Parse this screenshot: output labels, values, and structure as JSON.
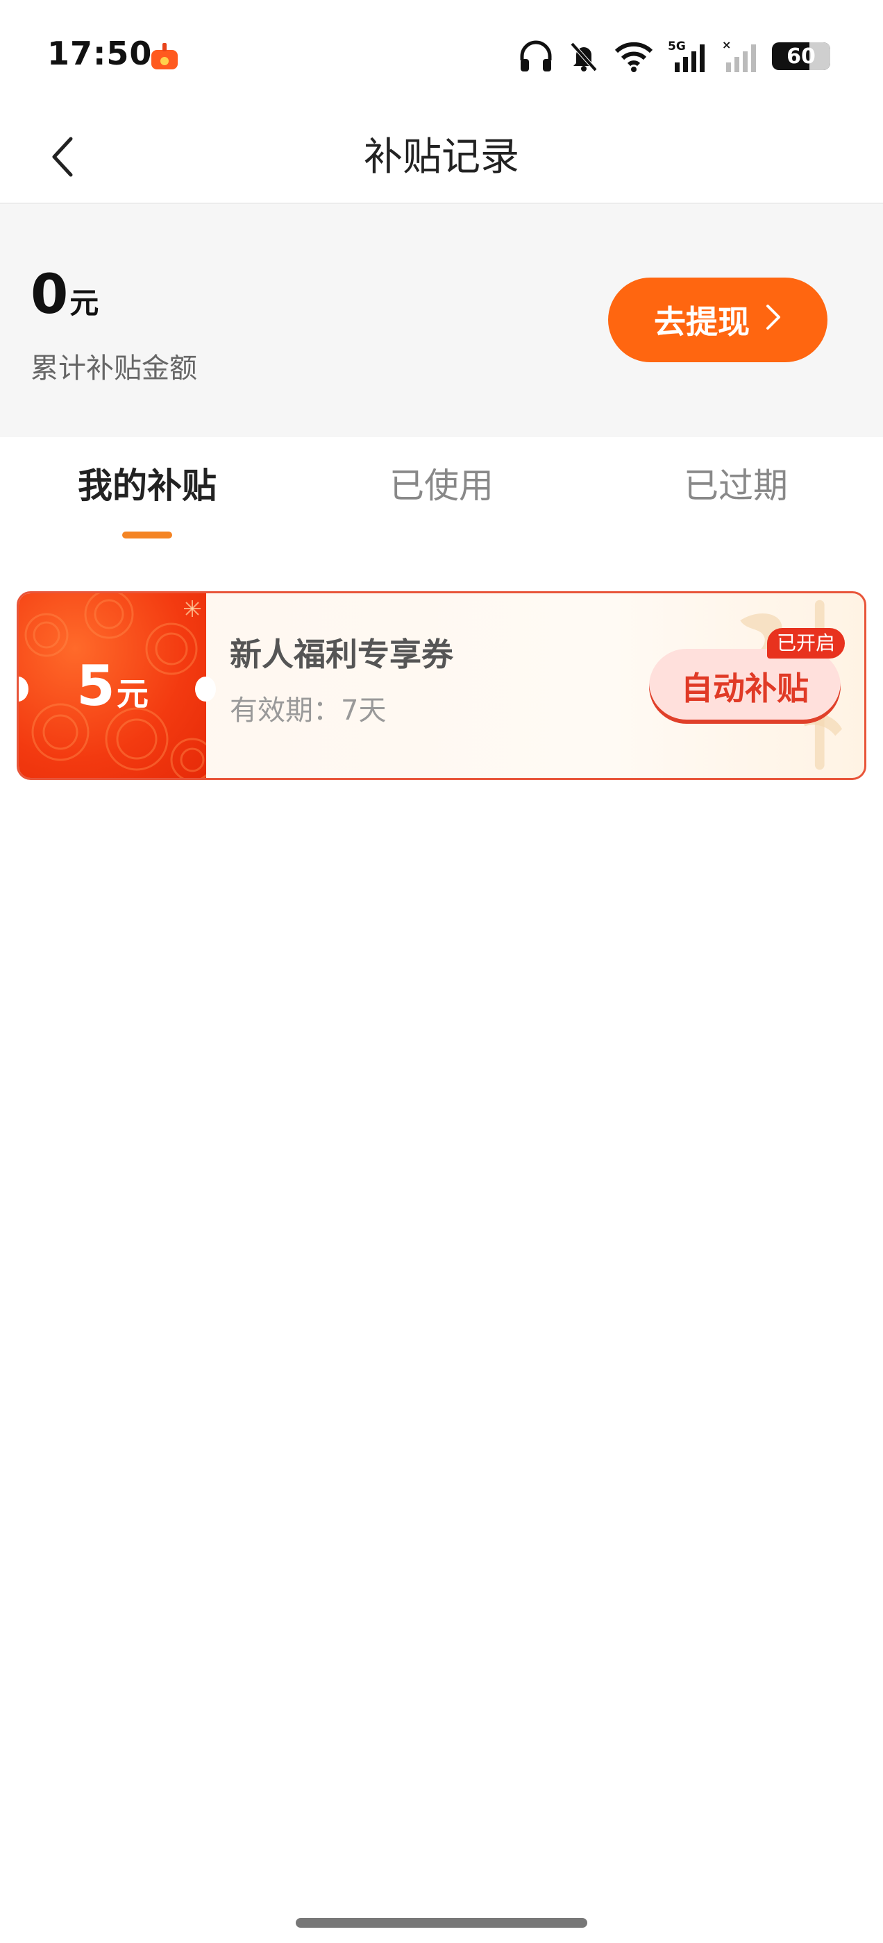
{
  "status_bar": {
    "time": "17:50",
    "network": "5G",
    "battery": "60",
    "icons": [
      "headphones-icon",
      "bell-muted-icon",
      "wifi-icon",
      "signal-5g-icon",
      "signal-no-service-icon",
      "battery-icon"
    ]
  },
  "nav": {
    "title": "补贴记录",
    "back_icon": "chevron-left-icon"
  },
  "summary": {
    "amount": "0",
    "unit": "元",
    "label": "累计补贴金额",
    "withdraw_label": "去提现",
    "accent_color": "#ff6610"
  },
  "tabs": [
    {
      "label": "我的补贴",
      "active": true
    },
    {
      "label": "已使用",
      "active": false
    },
    {
      "label": "已过期",
      "active": false
    }
  ],
  "coupons": [
    {
      "value": "5",
      "unit": "元",
      "title": "新人福利专享券",
      "validity": "有效期：7天",
      "action_label": "自动补贴",
      "badge": "已开启"
    }
  ]
}
